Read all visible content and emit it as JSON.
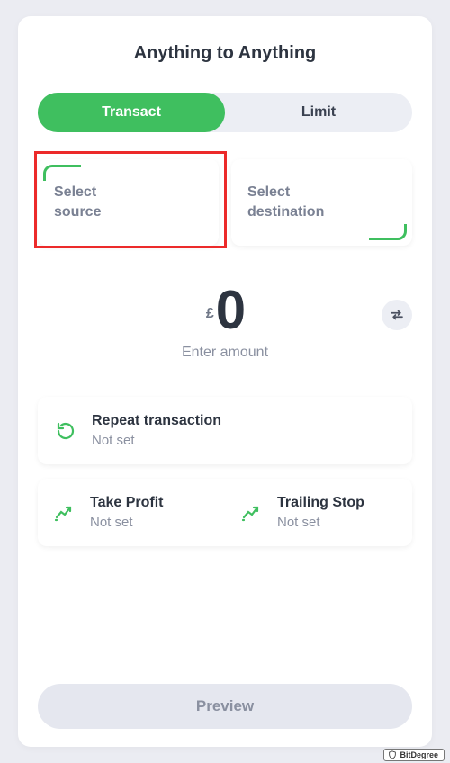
{
  "title": "Anything to Anything",
  "tabs": {
    "transact": "Transact",
    "limit": "Limit"
  },
  "select": {
    "source_line1": "Select",
    "source_line2": "source",
    "dest_line1": "Select",
    "dest_line2": "destination"
  },
  "amount": {
    "currency": "£",
    "value": "0",
    "hint": "Enter amount"
  },
  "repeat": {
    "title": "Repeat transaction",
    "sub": "Not set"
  },
  "takeprofit": {
    "title": "Take Profit",
    "sub": "Not set"
  },
  "trailing": {
    "title": "Trailing Stop",
    "sub": "Not set"
  },
  "preview": "Preview",
  "badge": "BitDegree"
}
